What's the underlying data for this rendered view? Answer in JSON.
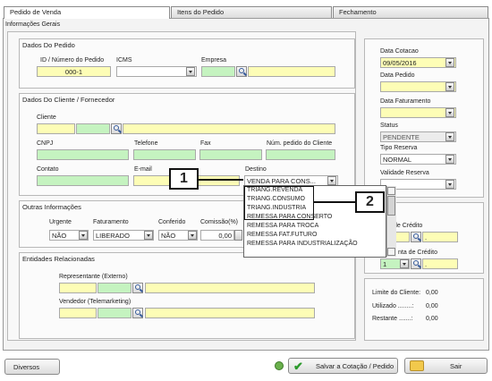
{
  "tabs": [
    {
      "label": "Pedido de Venda"
    },
    {
      "label": "Itens do Pedido"
    },
    {
      "label": "Fechamento"
    }
  ],
  "info_gerais": "Informações Gerais",
  "dados_pedido": {
    "title": "Dados Do Pedido",
    "id_label": "ID / Número do Pedido",
    "id_value": "000-1",
    "icms_label": "ICMS",
    "empresa_label": "Empresa"
  },
  "dados_cliente": {
    "title": "Dados Do Cliente / Fornecedor",
    "cliente_label": "Cliente",
    "cnpj_label": "CNPJ",
    "telefone_label": "Telefone",
    "fax_label": "Fax",
    "num_pedido_label": "Núm. pedido do Cliente",
    "contato_label": "Contato",
    "email_label": "E-mail",
    "destino_label": "Destino",
    "destino_value": "VENDA PARA CONS..."
  },
  "destino_options": [
    "TRIANG.REVENDA",
    "TRIANG.CONSUMO",
    "TRIANG.INDUSTRIA",
    "REMESSA PARA CONSERTO",
    "REMESSA PARA TROCA",
    "REMESSA FAT.FUTURO",
    "REMESSA  PARA INDUSTRIALIZAÇÃO"
  ],
  "outras": {
    "title": "Outras Informações",
    "urgente_label": "Urgente",
    "urgente_value": "NÃO",
    "faturamento_label": "Faturamento",
    "faturamento_value": "LIBERADO",
    "conferido_label": "Conferido",
    "conferido_value": "NÃO",
    "comissao_label": "Comissão(%)",
    "comissao_value": "0,00"
  },
  "entidades": {
    "title": "Entidades Relacionadas",
    "representante_label": "Representante (Externo)",
    "vendedor_label": "Vendedor (Telemarketing)"
  },
  "right": {
    "data_cotacao_label": "Data Cotacao",
    "data_cotacao_value": "09/05/2016",
    "data_pedido_label": "Data Pedido",
    "data_faturamento_label": "Data Faturamento",
    "status_label": "Status",
    "status_value": "PENDENTE",
    "tipo_reserva_label": "Tipo Reserva",
    "tipo_reserva_value": "NORMAL",
    "validade_label": "Validade Reserva",
    "credito_label_partial": "de Crédito",
    "conta_credito_label_partial": "nta de Crédito",
    "conta_value": "1",
    "dot1": ".",
    "dot2": ".",
    "limite_label": "Limite do Cliente:",
    "limite_value": "0,00",
    "utilizado_label": "Utilizado ........:",
    "utilizado_value": "0,00",
    "restante_label": "Restante .......:",
    "restante_value": "0,00"
  },
  "callouts": [
    "1",
    "2"
  ],
  "bottom": {
    "diversos": "Diversos",
    "salvar": "Salvar a Cotação / Pedido",
    "sair": "Sair"
  }
}
